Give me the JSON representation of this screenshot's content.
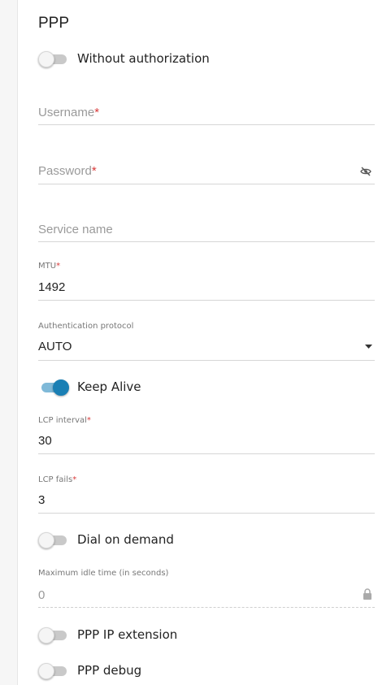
{
  "section_title": "PPP",
  "toggles": {
    "without_authorization": {
      "label": "Without authorization",
      "on": false
    },
    "keep_alive": {
      "label": "Keep Alive",
      "on": true
    },
    "dial_on_demand": {
      "label": "Dial on demand",
      "on": false
    },
    "ppp_ip_extension": {
      "label": "PPP IP extension",
      "on": false
    },
    "ppp_debug": {
      "label": "PPP debug",
      "on": false
    }
  },
  "fields": {
    "username": {
      "placeholder": "Username",
      "required": "*"
    },
    "password": {
      "placeholder": "Password",
      "required": "*",
      "icon": "eye-off-icon"
    },
    "service_name": {
      "placeholder": "Service name"
    },
    "mtu": {
      "label": "MTU",
      "required": "*",
      "value": "1492"
    },
    "auth_protocol": {
      "label": "Authentication protocol",
      "value": "AUTO",
      "icon": "dropdown-caret-icon"
    },
    "lcp_interval": {
      "label": "LCP interval",
      "required": "*",
      "value": "30"
    },
    "lcp_fails": {
      "label": "LCP fails",
      "required": "*",
      "value": "3"
    },
    "max_idle_time": {
      "label": "Maximum idle time (in seconds)",
      "value": "0",
      "icon": "lock-icon"
    }
  },
  "colors": {
    "accent": "#1a7fb4",
    "required": "#d83a3a"
  }
}
